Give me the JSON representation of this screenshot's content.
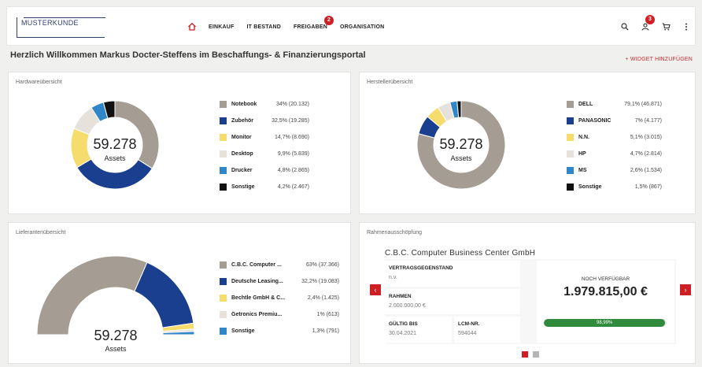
{
  "header": {
    "logo": "MUSTERKUNDE",
    "nav": [
      {
        "label": "EINKAUF"
      },
      {
        "label": "IT BESTAND"
      },
      {
        "label": "FREIGABEN",
        "badge": "2"
      },
      {
        "label": "ORGANISATION"
      }
    ],
    "tools": {
      "user_badge": "3"
    },
    "icons": [
      "home-icon",
      "search-icon",
      "user-icon",
      "cart-icon",
      "more-icon"
    ]
  },
  "welcome": "Herzlich Willkommen Markus Docter-Steffens im Beschaffungs- & Finanzierungsportal",
  "add_widget": "+ WIDGET HINZUFÜGEN",
  "colors": {
    "accent": "#cf1e24",
    "navy": "#1a3f8f",
    "progress": "#2f8a3c"
  },
  "hardware": {
    "title": "Hardwareübersicht",
    "center_value": "59.278",
    "center_label": "Assets",
    "items": [
      {
        "name": "Notebook",
        "value": "34% (20.132)",
        "pct": 34,
        "color": "#a59d94"
      },
      {
        "name": "Zubehör",
        "value": "32,5% (19.285)",
        "pct": 32.5,
        "color": "#1a3f8f"
      },
      {
        "name": "Monitor",
        "value": "14,7% (8.690)",
        "pct": 14.7,
        "color": "#f6dc6c"
      },
      {
        "name": "Desktop",
        "value": "9,9% (5.839)",
        "pct": 9.9,
        "color": "#e6e1da"
      },
      {
        "name": "Drucker",
        "value": "4,8% (2.865)",
        "pct": 4.8,
        "color": "#2f86c8"
      },
      {
        "name": "Sonstige",
        "value": "4,2% (2.467)",
        "pct": 4.2,
        "color": "#111111"
      }
    ]
  },
  "manufacturer": {
    "title": "Herstellerübersicht",
    "center_value": "59.278",
    "center_label": "Assets",
    "items": [
      {
        "name": "DELL",
        "value": "79,1% (46.871)",
        "pct": 79.1,
        "color": "#a59d94"
      },
      {
        "name": "PANASONIC",
        "value": "7% (4.177)",
        "pct": 7,
        "color": "#1a3f8f"
      },
      {
        "name": "N.N.",
        "value": "5,1% (3.015)",
        "pct": 5.1,
        "color": "#f6dc6c"
      },
      {
        "name": "HP",
        "value": "4,7% (2.814)",
        "pct": 4.7,
        "color": "#e6e1da"
      },
      {
        "name": "MS",
        "value": "2,6% (1.534)",
        "pct": 2.6,
        "color": "#2f86c8"
      },
      {
        "name": "Sonstige",
        "value": "1,5% (867)",
        "pct": 1.5,
        "color": "#111111"
      }
    ]
  },
  "supplier": {
    "title": "Lieferantenübersicht",
    "center_value": "59.278",
    "center_label": "Assets",
    "items": [
      {
        "name": "C.B.C. Computer ...",
        "value": "63% (37.366)",
        "pct": 63,
        "color": "#a59d94"
      },
      {
        "name": "Deutsche Leasing...",
        "value": "32,2% (19.083)",
        "pct": 32.2,
        "color": "#1a3f8f"
      },
      {
        "name": "Bechtle GmbH & C...",
        "value": "2,4% (1.425)",
        "pct": 2.4,
        "color": "#f6dc6c"
      },
      {
        "name": "Getronics Premiu...",
        "value": "1% (613)",
        "pct": 1,
        "color": "#e6e1da"
      },
      {
        "name": "Sonstige",
        "value": "1,3% (791)",
        "pct": 1.3,
        "color": "#2f86c8"
      }
    ]
  },
  "framework": {
    "title": "Rahmenausschöpfung",
    "company": "C.B.C. Computer Business Center GmbH",
    "subject_label": "VERTRAGSGEGENSTAND",
    "subject_value": "n.v.",
    "frame_label": "RAHMEN",
    "frame_value": "2.000.000,00 €",
    "valid_label": "GÜLTIG BIS",
    "valid_value": "30.04.2021",
    "lcm_label": "LCM-NR.",
    "lcm_value": "594044",
    "available_label": "NOCH VERFÜGBAR",
    "available_value": "1.979.815,00 €",
    "progress_text": "98,99%",
    "progress": 0.9899,
    "prev_arrow": "‹",
    "next_arrow": "›"
  }
}
